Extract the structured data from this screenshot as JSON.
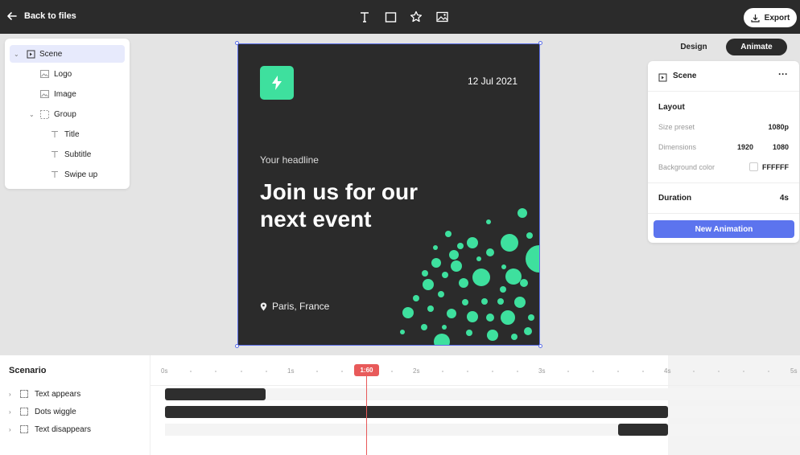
{
  "topbar": {
    "back_label": "Back to files",
    "export_label": "Export",
    "tools": [
      "text-tool-icon",
      "rectangle-tool-icon",
      "star-tool-icon",
      "image-tool-icon"
    ]
  },
  "layers": {
    "items": [
      {
        "label": "Scene",
        "icon": "frame-icon",
        "expanded": true,
        "selected": true
      },
      {
        "label": "Logo",
        "icon": "image-icon"
      },
      {
        "label": "Image",
        "icon": "image-icon"
      },
      {
        "label": "Group",
        "icon": "group-icon",
        "expanded": true
      },
      {
        "label": "Title",
        "icon": "text-icon"
      },
      {
        "label": "Subtitle",
        "icon": "text-icon"
      },
      {
        "label": "Swipe up",
        "icon": "text-icon"
      }
    ]
  },
  "artboard": {
    "date": "12 Jul 2021",
    "headline": "Your headline",
    "title": "Join us for our next event",
    "location": "Paris, France",
    "accent": "#3ee09e",
    "background": "#2b2b2b"
  },
  "mode_tabs": {
    "design": "Design",
    "animate": "Animate",
    "active": "Animate"
  },
  "properties": {
    "header": "Scene",
    "more": "···",
    "layout_title": "Layout",
    "size_preset_label": "Size preset",
    "size_preset_value": "1080p",
    "dimensions_label": "Dimensions",
    "width": "1920",
    "height": "1080",
    "bg_label": "Background color",
    "bg_value": "FFFFFF",
    "duration_label": "Duration",
    "duration_value": "4s",
    "new_animation": "New Animation"
  },
  "timeline": {
    "title": "Scenario",
    "rows": [
      "Text appears",
      "Dots wiggle",
      "Text disappears"
    ],
    "ticks": [
      "0s",
      "1s",
      "2s",
      "3s",
      "4s",
      "5s"
    ],
    "playhead": "1:60"
  }
}
